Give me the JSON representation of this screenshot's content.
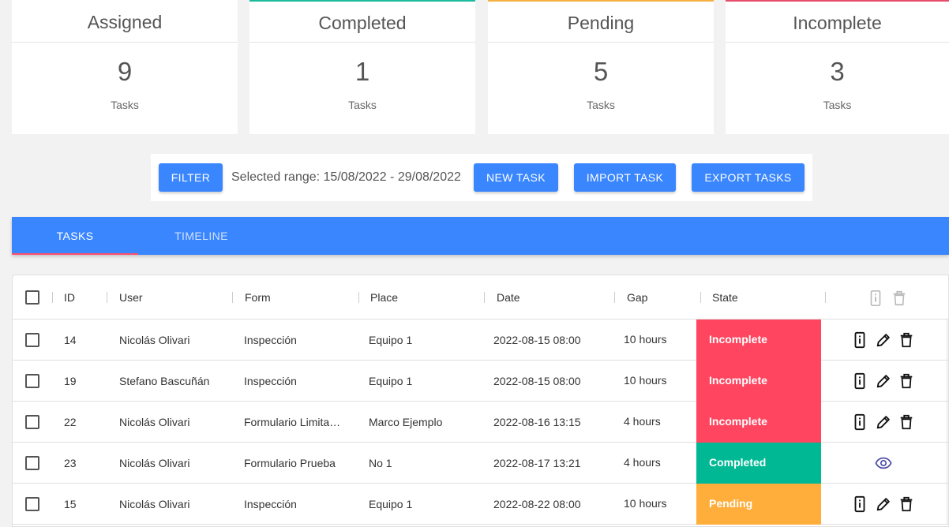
{
  "stats": [
    {
      "title": "Assigned",
      "count": "9",
      "unit": "Tasks"
    },
    {
      "title": "Completed",
      "count": "1",
      "unit": "Tasks"
    },
    {
      "title": "Pending",
      "count": "5",
      "unit": "Tasks"
    },
    {
      "title": "Incomplete",
      "count": "3",
      "unit": "Tasks"
    }
  ],
  "colors": {
    "primary": "#3a86ff",
    "completed": "#00b894",
    "pending": "#ffad3b",
    "incomplete": "#ff4560",
    "tab_indicator": "#ff4f6d"
  },
  "toolbar": {
    "filter_label": "FILTER",
    "selected_range": "Selected range: 15/08/2022 - 29/08/2022",
    "new_task_label": "NEW TASK",
    "import_task_label": "IMPORT TASK",
    "export_tasks_label": "EXPORT TASKS"
  },
  "tabs": [
    {
      "label": "TASKS",
      "active": true
    },
    {
      "label": "TIMELINE",
      "active": false
    }
  ],
  "table": {
    "columns": [
      "ID",
      "User",
      "Form",
      "Place",
      "Date",
      "Gap",
      "State"
    ],
    "header_icons": [
      "device-info-icon",
      "trash-icon"
    ],
    "rows": [
      {
        "id": "14",
        "user": "Nicolás Olivari",
        "form": "Inspección",
        "place": "Equipo 1",
        "date": "2022-08-15 08:00",
        "gap": "10 hours",
        "state": "Incomplete",
        "actions": [
          "device-info-icon",
          "pencil-icon",
          "trash-icon"
        ]
      },
      {
        "id": "19",
        "user": "Stefano Bascuñán",
        "form": "Inspección",
        "place": "Equipo 1",
        "date": "2022-08-15 08:00",
        "gap": "10 hours",
        "state": "Incomplete",
        "actions": [
          "device-info-icon",
          "pencil-icon",
          "trash-icon"
        ]
      },
      {
        "id": "22",
        "user": "Nicolás Olivari",
        "form": "Formulario Limita…",
        "place": "Marco Ejemplo",
        "date": "2022-08-16 13:15",
        "gap": "4 hours",
        "state": "Incomplete",
        "actions": [
          "device-info-icon",
          "pencil-icon",
          "trash-icon"
        ]
      },
      {
        "id": "23",
        "user": "Nicolás Olivari",
        "form": "Formulario Prueba",
        "place": "No 1",
        "date": "2022-08-17 13:21",
        "gap": "4 hours",
        "state": "Completed",
        "actions": [
          "eye-icon"
        ]
      },
      {
        "id": "15",
        "user": "Nicolás Olivari",
        "form": "Inspección",
        "place": "Equipo 1",
        "date": "2022-08-22 08:00",
        "gap": "10 hours",
        "state": "Pending",
        "actions": [
          "device-info-icon",
          "pencil-icon",
          "trash-icon"
        ]
      }
    ]
  }
}
